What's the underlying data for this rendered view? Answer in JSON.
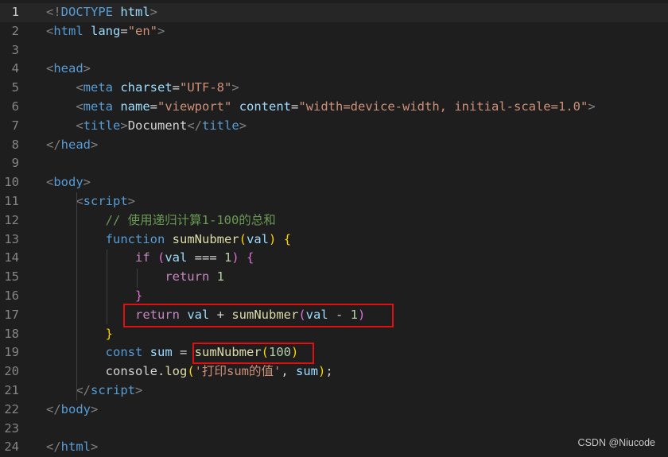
{
  "editor": {
    "language": "html",
    "active_line": 1,
    "colors": {
      "background": "#1e1e1e",
      "gutter": "#858585",
      "highlight_box": "#e01010"
    },
    "lines": [
      {
        "n": "1",
        "tokens": [
          [
            "<!",
            "t-punc"
          ],
          [
            "DOCTYPE",
            "t-tag"
          ],
          [
            " ",
            "t-txt"
          ],
          [
            "html",
            "t-attr"
          ],
          [
            ">",
            "t-punc"
          ]
        ]
      },
      {
        "n": "2",
        "tokens": [
          [
            "<",
            "t-punc"
          ],
          [
            "html",
            "t-tag"
          ],
          [
            " ",
            "t-txt"
          ],
          [
            "lang",
            "t-attr"
          ],
          [
            "=",
            "t-txt"
          ],
          [
            "\"en\"",
            "t-str"
          ],
          [
            ">",
            "t-punc"
          ]
        ]
      },
      {
        "n": "3",
        "tokens": []
      },
      {
        "n": "4",
        "tokens": [
          [
            "<",
            "t-punc"
          ],
          [
            "head",
            "t-tag"
          ],
          [
            ">",
            "t-punc"
          ]
        ]
      },
      {
        "n": "5",
        "tokens": [
          [
            "    ",
            "t-txt"
          ],
          [
            "<",
            "t-punc"
          ],
          [
            "meta",
            "t-tag"
          ],
          [
            " ",
            "t-txt"
          ],
          [
            "charset",
            "t-attr"
          ],
          [
            "=",
            "t-txt"
          ],
          [
            "\"UTF-8\"",
            "t-str"
          ],
          [
            ">",
            "t-punc"
          ]
        ]
      },
      {
        "n": "6",
        "tokens": [
          [
            "    ",
            "t-txt"
          ],
          [
            "<",
            "t-punc"
          ],
          [
            "meta",
            "t-tag"
          ],
          [
            " ",
            "t-txt"
          ],
          [
            "name",
            "t-attr"
          ],
          [
            "=",
            "t-txt"
          ],
          [
            "\"viewport\"",
            "t-str"
          ],
          [
            " ",
            "t-txt"
          ],
          [
            "content",
            "t-attr"
          ],
          [
            "=",
            "t-txt"
          ],
          [
            "\"width=device-width, initial-scale=1.0\"",
            "t-str"
          ],
          [
            ">",
            "t-punc"
          ]
        ]
      },
      {
        "n": "7",
        "tokens": [
          [
            "    ",
            "t-txt"
          ],
          [
            "<",
            "t-punc"
          ],
          [
            "title",
            "t-tag"
          ],
          [
            ">",
            "t-punc"
          ],
          [
            "Document",
            "t-txt"
          ],
          [
            "</",
            "t-punc"
          ],
          [
            "title",
            "t-tag"
          ],
          [
            ">",
            "t-punc"
          ]
        ]
      },
      {
        "n": "8",
        "tokens": [
          [
            "</",
            "t-punc"
          ],
          [
            "head",
            "t-tag"
          ],
          [
            ">",
            "t-punc"
          ]
        ]
      },
      {
        "n": "9",
        "tokens": []
      },
      {
        "n": "10",
        "tokens": [
          [
            "<",
            "t-punc"
          ],
          [
            "body",
            "t-tag"
          ],
          [
            ">",
            "t-punc"
          ]
        ]
      },
      {
        "n": "11",
        "tokens": [
          [
            "    ",
            "t-txt"
          ],
          [
            "<",
            "t-punc"
          ],
          [
            "script",
            "t-tag"
          ],
          [
            ">",
            "t-punc"
          ]
        ]
      },
      {
        "n": "12",
        "tokens": [
          [
            "        ",
            "t-txt"
          ],
          [
            "// 使用递归计算1-100的总和",
            "t-com"
          ]
        ]
      },
      {
        "n": "13",
        "tokens": [
          [
            "        ",
            "t-txt"
          ],
          [
            "function",
            "t-kw"
          ],
          [
            " ",
            "t-txt"
          ],
          [
            "sumNubmer",
            "t-fn"
          ],
          [
            "(",
            "t-br1"
          ],
          [
            "val",
            "t-var"
          ],
          [
            ")",
            "t-br1"
          ],
          [
            " ",
            "t-txt"
          ],
          [
            "{",
            "t-br1"
          ]
        ]
      },
      {
        "n": "14",
        "tokens": [
          [
            "            ",
            "t-txt"
          ],
          [
            "if",
            "t-ctl"
          ],
          [
            " ",
            "t-txt"
          ],
          [
            "(",
            "t-br2"
          ],
          [
            "val",
            "t-var"
          ],
          [
            " === ",
            "t-txt"
          ],
          [
            "1",
            "t-num"
          ],
          [
            ")",
            "t-br2"
          ],
          [
            " ",
            "t-txt"
          ],
          [
            "{",
            "t-br2"
          ]
        ]
      },
      {
        "n": "15",
        "tokens": [
          [
            "                ",
            "t-txt"
          ],
          [
            "return",
            "t-ctl"
          ],
          [
            " ",
            "t-txt"
          ],
          [
            "1",
            "t-num"
          ]
        ]
      },
      {
        "n": "16",
        "tokens": [
          [
            "            ",
            "t-txt"
          ],
          [
            "}",
            "t-br2"
          ]
        ]
      },
      {
        "n": "17",
        "tokens": [
          [
            "            ",
            "t-txt"
          ],
          [
            "return",
            "t-ctl"
          ],
          [
            " ",
            "t-txt"
          ],
          [
            "val",
            "t-var"
          ],
          [
            " + ",
            "t-txt"
          ],
          [
            "sumNubmer",
            "t-fn"
          ],
          [
            "(",
            "t-br2"
          ],
          [
            "val",
            "t-var"
          ],
          [
            " - ",
            "t-txt"
          ],
          [
            "1",
            "t-num"
          ],
          [
            ")",
            "t-br2"
          ]
        ]
      },
      {
        "n": "18",
        "tokens": [
          [
            "        ",
            "t-txt"
          ],
          [
            "}",
            "t-br1"
          ]
        ]
      },
      {
        "n": "19",
        "tokens": [
          [
            "        ",
            "t-txt"
          ],
          [
            "const",
            "t-kw"
          ],
          [
            " ",
            "t-txt"
          ],
          [
            "sum",
            "t-var"
          ],
          [
            " = ",
            "t-txt"
          ],
          [
            "sumNubmer",
            "t-fn"
          ],
          [
            "(",
            "t-br1"
          ],
          [
            "100",
            "t-num"
          ],
          [
            ")",
            "t-br1"
          ]
        ]
      },
      {
        "n": "20",
        "tokens": [
          [
            "        ",
            "t-txt"
          ],
          [
            "console",
            "t-txt"
          ],
          [
            ".",
            "t-txt"
          ],
          [
            "log",
            "t-fn"
          ],
          [
            "(",
            "t-br1"
          ],
          [
            "'打印sum的值'",
            "t-str"
          ],
          [
            ", ",
            "t-txt"
          ],
          [
            "sum",
            "t-var"
          ],
          [
            ")",
            "t-br1"
          ],
          [
            ";",
            "t-txt"
          ]
        ]
      },
      {
        "n": "21",
        "tokens": [
          [
            "    ",
            "t-txt"
          ],
          [
            "</",
            "t-punc"
          ],
          [
            "script",
            "t-tag"
          ],
          [
            ">",
            "t-punc"
          ]
        ]
      },
      {
        "n": "22",
        "tokens": [
          [
            "</",
            "t-punc"
          ],
          [
            "body",
            "t-tag"
          ],
          [
            ">",
            "t-punc"
          ]
        ]
      },
      {
        "n": "23",
        "tokens": []
      },
      {
        "n": "24",
        "tokens": [
          [
            "</",
            "t-punc"
          ],
          [
            "html",
            "t-tag"
          ],
          [
            ">",
            "t-punc"
          ]
        ]
      }
    ]
  },
  "watermark": "CSDN @Niucode"
}
